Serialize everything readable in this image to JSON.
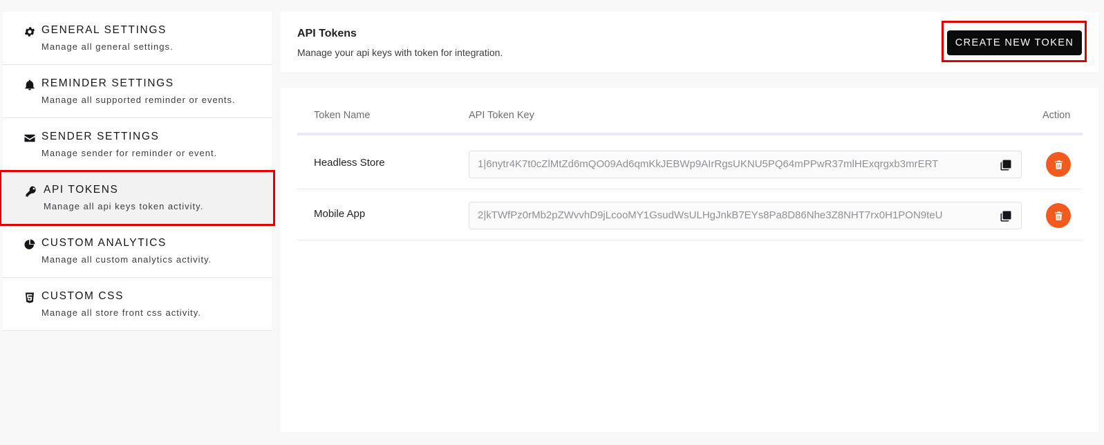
{
  "sidebar": {
    "items": [
      {
        "title": "GENERAL SETTINGS",
        "desc": "Manage all general settings.",
        "icon": "gear-icon"
      },
      {
        "title": "REMINDER SETTINGS",
        "desc": "Manage all supported reminder or events.",
        "icon": "bell-icon"
      },
      {
        "title": "SENDER SETTINGS",
        "desc": "Manage sender for reminder or event.",
        "icon": "envelope-icon"
      },
      {
        "title": "API TOKENS",
        "desc": "Manage all api keys token activity.",
        "icon": "key-icon",
        "active": true
      },
      {
        "title": "CUSTOM ANALYTICS",
        "desc": "Manage all custom analytics activity.",
        "icon": "pie-chart-icon"
      },
      {
        "title": "CUSTOM CSS",
        "desc": "Manage all store front css activity.",
        "icon": "css3-icon"
      }
    ]
  },
  "header": {
    "title": "API Tokens",
    "subtitle": "Manage your api keys with token for integration.",
    "create_label": "CREATE NEW TOKEN"
  },
  "table": {
    "columns": [
      "Token Name",
      "API Token Key",
      "Action"
    ],
    "rows": [
      {
        "name": "Headless Store",
        "key": "1|6nytr4K7t0cZlMtZd6mQO09Ad6qmKkJEBWp9AIrRgsUKNU5PQ64mPPwR37mlHExqrgxb3mrERT"
      },
      {
        "name": "Mobile App",
        "key": "2|kTWfPz0rMb2pZWvvhD9jLcooMY1GsudWsULHgJnkB7EYs8Pa8D86Nhe3Z8NHT7rx0H1PON9teU"
      }
    ]
  },
  "colors": {
    "highlight": "#e30000",
    "delete": "#f35a1e",
    "primary_button": "#0a0a0a"
  }
}
